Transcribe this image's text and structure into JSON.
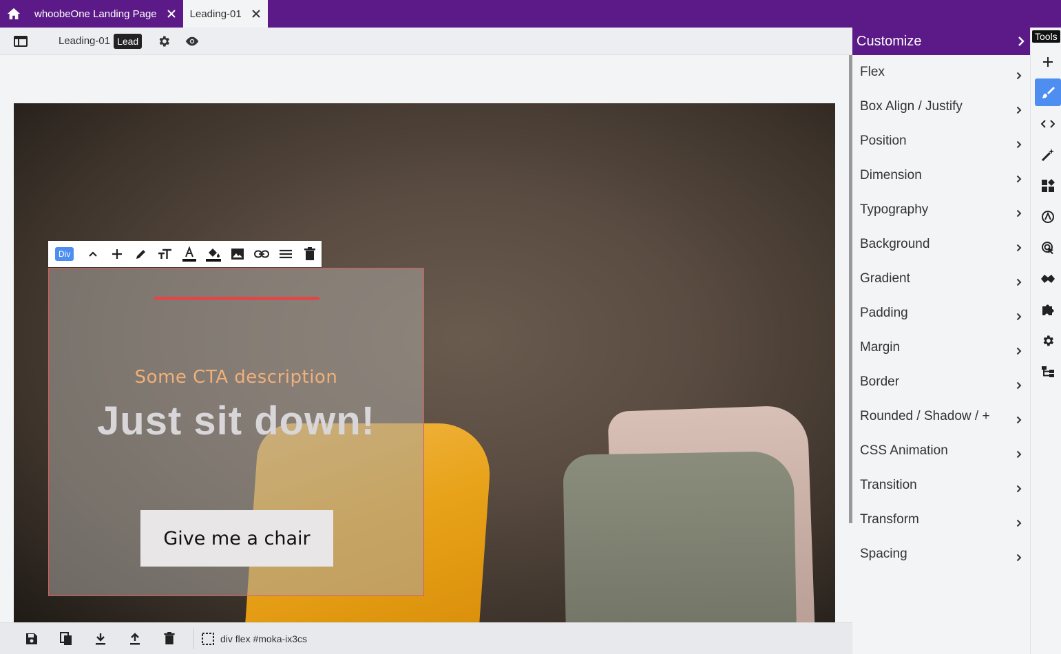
{
  "tabs": [
    {
      "label": "whoobeOne Landing Page"
    },
    {
      "label": "Leading-01"
    }
  ],
  "editor": {
    "page_name": "Leading-01",
    "page_badge": "Lead"
  },
  "canvas": {
    "element_tag": "Div",
    "cta_description": "Some CTA description",
    "cta_title": "Just sit down!",
    "cta_button": "Give me a chair"
  },
  "customize": {
    "title": "Customize",
    "items": [
      {
        "label": "Flex"
      },
      {
        "label": "Box Align / Justify"
      },
      {
        "label": "Position"
      },
      {
        "label": "Dimension"
      },
      {
        "label": "Typography"
      },
      {
        "label": "Background"
      },
      {
        "label": "Gradient"
      },
      {
        "label": "Padding"
      },
      {
        "label": "Margin"
      },
      {
        "label": "Border"
      },
      {
        "label": "Rounded / Shadow / +"
      },
      {
        "label": "CSS Animation"
      },
      {
        "label": "Transition"
      },
      {
        "label": "Transform"
      },
      {
        "label": "Spacing"
      }
    ]
  },
  "tools": {
    "label": "Tools",
    "icons": [
      "plus-icon",
      "brush-icon",
      "code-icon",
      "magic-wand-icon",
      "widgets-icon",
      "animation-icon",
      "cursor-target-icon",
      "mask-icon",
      "puzzle-icon",
      "settings-icon",
      "tree-icon"
    ]
  },
  "status_bar": {
    "selection_path": "div flex #moka-ix3cs"
  },
  "colors": {
    "brand_purple": "#5b1a87",
    "accent_blue": "#4e8ef1",
    "accent_red": "#e04848"
  }
}
